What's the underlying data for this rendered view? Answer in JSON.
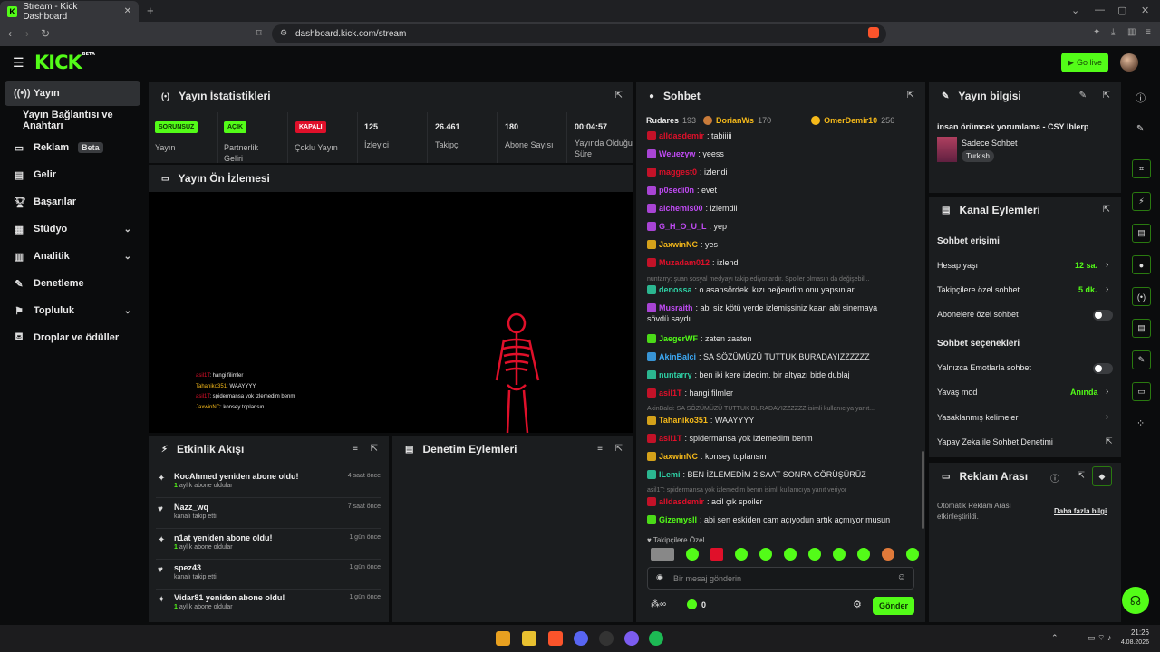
{
  "browser": {
    "tab_title": "Stream - Kick Dashboard",
    "url": "dashboard.kick.com/stream"
  },
  "header": {
    "logo": "KICK",
    "logo_beta": "BETA",
    "go_live": "Go live"
  },
  "sidebar": {
    "items": [
      {
        "label": "Yayın",
        "icon": "broadcast-icon"
      },
      {
        "label": "Yayın Bağlantısı ve Anahtarı"
      },
      {
        "label": "Reklam",
        "badge": "Beta",
        "icon": "ad-icon"
      },
      {
        "label": "Gelir",
        "icon": "revenue-icon"
      },
      {
        "label": "Başarılar",
        "icon": "trophy-icon"
      },
      {
        "label": "Stüdyo",
        "icon": "studio-icon"
      },
      {
        "label": "Analitik",
        "icon": "chart-icon"
      },
      {
        "label": "Denetleme",
        "icon": "wrench-icon"
      },
      {
        "label": "Topluluk",
        "icon": "community-icon"
      },
      {
        "label": "Droplar ve ödüller",
        "icon": "drops-icon"
      }
    ]
  },
  "stats": {
    "title": "Yayın İstatistikleri",
    "cells": [
      {
        "badge": "SORUNSUZ",
        "label": "Yayın"
      },
      {
        "badge": "AÇIK",
        "label": "Partnerlik Geliri"
      },
      {
        "badge": "KAPALI",
        "label": "Çoklu Yayın"
      },
      {
        "value": "125",
        "label": "İzleyici"
      },
      {
        "value": "26.461",
        "label": "Takipçi"
      },
      {
        "value": "180",
        "label": "Abone Sayısı"
      },
      {
        "value": "00:04:57",
        "label": "Yayında Olduğu Süre"
      }
    ],
    "colors": {
      "ok": "#53fc18",
      "off": "#e0102a"
    }
  },
  "preview": {
    "title": "Yayın Ön İzlemesi",
    "overlay_chat": [
      {
        "user": "asil1T",
        "msg": ": hangi filimler"
      },
      {
        "user": "Tahaniko351",
        "msg": ": WAAYYYY"
      },
      {
        "user": "asil1T",
        "msg": ": spidermansa yok izlemedim benm"
      },
      {
        "user": "JaxwinNC",
        "msg": ": konsey toplansın"
      }
    ]
  },
  "activity": {
    "title": "Etkinlik Akışı",
    "items": [
      {
        "title": "KocAhmed yeniden abone oldu!",
        "count": "1",
        "sub": " aylık abone oldular",
        "time": "4 saat önce",
        "icon": "sub-icon"
      },
      {
        "title": "Nazz_wq",
        "sub": "kanalı takip etti",
        "time": "7 saat önce",
        "icon": "heart-icon"
      },
      {
        "title": "n1at yeniden abone oldu!",
        "count": "1",
        "sub": " aylık abone oldular",
        "time": "1 gün önce",
        "icon": "sub-icon"
      },
      {
        "title": "spez43",
        "sub": "kanalı takip etti",
        "time": "1 gün önce",
        "icon": "heart-icon"
      },
      {
        "title": "Vidar81 yeniden abone oldu!",
        "count": "1",
        "sub": " aylık abone oldular",
        "time": "1 gün önce",
        "icon": "sub-icon"
      }
    ]
  },
  "moderation": {
    "title": "Denetim Eylemleri"
  },
  "chat": {
    "title": "Sohbet",
    "top_gifters": [
      {
        "name": "Rudares",
        "count": "193"
      },
      {
        "name": "DorianWs",
        "count": "170"
      },
      {
        "name": "OmerDemir10",
        "count": "256"
      }
    ],
    "messages": [
      {
        "user": "alldasdemir",
        "color": "#e0102a",
        "text": ": tabiiiii"
      },
      {
        "user": "Weuezyw",
        "color": "#c14bf5",
        "text": ": yeess"
      },
      {
        "user": "maggest0",
        "color": "#e0102a",
        "text": ": izlendi"
      },
      {
        "user": "p0sedi0n",
        "color": "#c14bf5",
        "text": ": evet"
      },
      {
        "user": "alchemis00",
        "color": "#c14bf5",
        "text": ": izlemdii"
      },
      {
        "user": "G_H_O_U_L",
        "color": "#c14bf5",
        "text": ": yep"
      },
      {
        "user": "JaxwinNC",
        "color": "#f5b91a",
        "text": ": yes"
      },
      {
        "user": "Muzadam012",
        "color": "#e0102a",
        "text": ": izlendi"
      },
      {
        "system": "nuntarry: şuan sosyal medyayı takip ediyorlardır. Spoiler olmasın da değişebil..."
      },
      {
        "user": "denossa",
        "color": "#2ed1a5",
        "text": ": o asansördeki kızı beğendim onu yapsınlar"
      },
      {
        "user": "Musraith",
        "color": "#c14bf5",
        "text": ": abi siz kötü yerde izlemişsiniz kaan abi sinemaya",
        "text2": "sövdü saydı"
      },
      {
        "user": "JaegerWF",
        "color": "#53fc18",
        "text": ": zaten zaaten"
      },
      {
        "user": "AkinBalci",
        "color": "#3da9f5",
        "text": ": SA SÖZÜMÜZÜ TUTTUK BURADAYIZZZZZZ"
      },
      {
        "user": "nuntarry",
        "color": "#2ed1a5",
        "text": ": ben iki kere izledim. bir altyazı bide dublaj"
      },
      {
        "user": "asil1T",
        "color": "#e0102a",
        "text": ": hangi filmler"
      },
      {
        "system": "AkinBalci: SA SÖZÜMÜZÜ TUTTUK BURADAYIZZZZZZ isimli kullanıcıya yanıt..."
      },
      {
        "user": "Tahaniko351",
        "color": "#f5b91a",
        "text": ": WAAYYYY"
      },
      {
        "user": "asil1T",
        "color": "#e0102a",
        "text": ": spidermansa yok izlemedim benm"
      },
      {
        "user": "JaxwinNC",
        "color": "#f5b91a",
        "text": ": konsey toplansın"
      },
      {
        "user": "ILemi",
        "color": "#2ed1a5",
        "text": ": BEN İZLEMEDİM 2 SAAT SONRA GÖRÜŞÜRÜZ"
      },
      {
        "system": "asil1T: spidermansa yok izlemedim benm isimli kullanıcıya yanıt veriyor"
      },
      {
        "user": "alldasdemir",
        "color": "#e0102a",
        "text": ": acil çık spoiler"
      },
      {
        "user": "Gizemysll",
        "color": "#53fc18",
        "text": ": abi sen eskiden cam açıyodun artık açmıyor musun"
      }
    ],
    "emote_label": "Takipçilere Özel",
    "input_placeholder": "Bir mesaj gönderin",
    "points": "0",
    "send": "Gönder"
  },
  "stream_info": {
    "title": "Yayın bilgisi",
    "stream_title": "insan örümcek yorumlama - CSY lblerp",
    "category": "Sadece Sohbet",
    "language": "Turkish"
  },
  "channel_actions": {
    "title": "Kanal Eylemleri",
    "access_title": "Sohbet erişimi",
    "account_age": "Hesap yaşı",
    "account_age_val": "12 sa.",
    "followers_only": "Takipçilere özel sohbet",
    "followers_only_val": "5 dk.",
    "subs_only": "Abonelere özel sohbet",
    "options_title": "Sohbet seçenekleri",
    "emotes_only": "Yalnızca Emotlarla sohbet",
    "slow_mode": "Yavaş mod",
    "slow_mode_val": "Anında",
    "banned_words": "Yasaklanmış kelimeler",
    "ai_mod": "Yapay Zeka ile Sohbet Denetimi"
  },
  "ad_break": {
    "title": "Reklam Arası",
    "text1": "Otomatik Reklam Arası",
    "text2": "etkinleştirildi.",
    "link": "Daha fazla bilgi"
  },
  "taskbar": {
    "time": "21:26",
    "date": "4.08.2026"
  }
}
